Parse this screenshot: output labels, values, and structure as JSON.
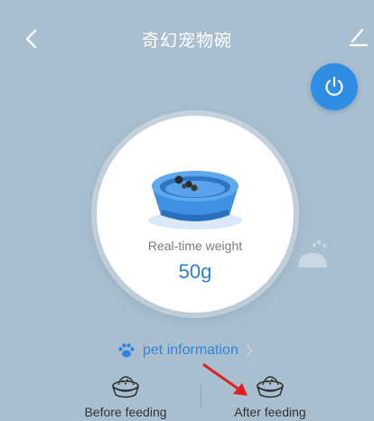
{
  "header": {
    "title": "奇幻宠物碗",
    "back_icon": "chevron-left-icon",
    "edit_icon": "pencil-icon"
  },
  "power_button": {
    "icon": "power-icon",
    "color": "#2f8de4"
  },
  "weight_display": {
    "label": "Real-time weight",
    "value": "50g",
    "bowl_icon": "pet-bowl-icon"
  },
  "pet_info": {
    "label": "pet information",
    "icon": "paw-icon"
  },
  "feeding": {
    "before_label": "Before feeding",
    "after_label": "After feeding",
    "icon": "food-bowl-icon"
  },
  "annotation": {
    "icon": "red-arrow-icon",
    "color": "#e02020"
  },
  "colors": {
    "background": "#a9bfcf",
    "accent": "#2f86dc"
  }
}
